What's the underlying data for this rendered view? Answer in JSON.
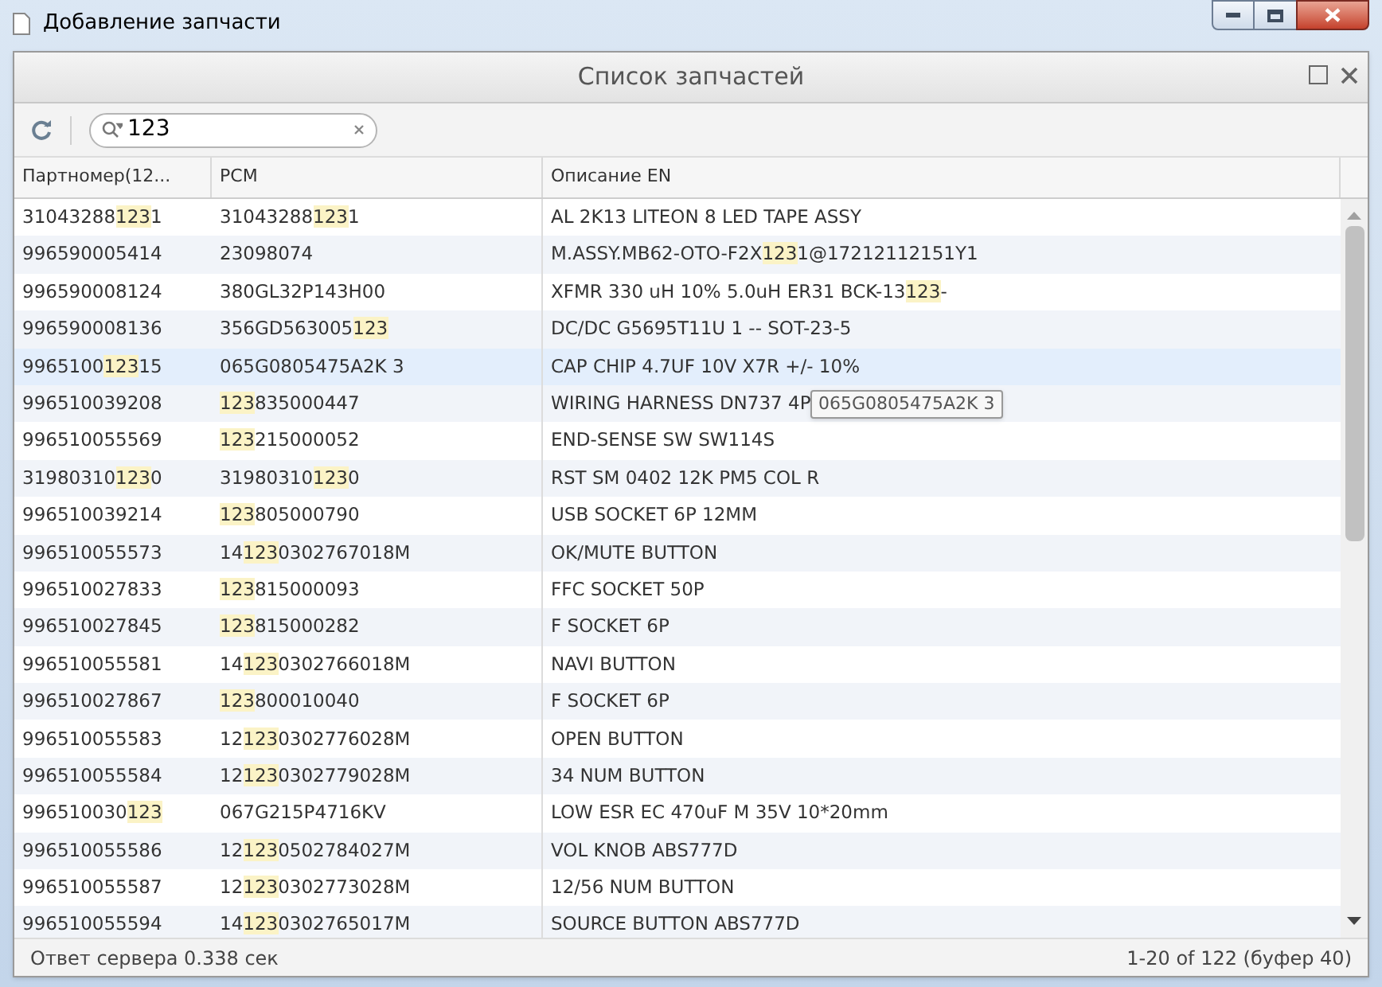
{
  "window": {
    "title": "Добавление запчасти"
  },
  "dialog": {
    "title": "Список запчастей"
  },
  "search": {
    "value": "123"
  },
  "table": {
    "columns": [
      "Партномер(12...",
      "PCM",
      "Описание EN"
    ],
    "rows": [
      {
        "selected": false,
        "cells": [
          [
            {
              "text": "31043288",
              "match": false
            },
            {
              "text": "123",
              "match": true
            },
            {
              "text": "1",
              "match": false
            }
          ],
          [
            {
              "text": "31043288",
              "match": false
            },
            {
              "text": "123",
              "match": true
            },
            {
              "text": "1",
              "match": false
            }
          ],
          [
            {
              "text": "AL 2K13 LITEON 8 LED TAPE ASSY",
              "match": false
            }
          ]
        ]
      },
      {
        "selected": false,
        "cells": [
          [
            {
              "text": "996590005414",
              "match": false
            }
          ],
          [
            {
              "text": "23098074",
              "match": false
            }
          ],
          [
            {
              "text": "M.ASSY.MB62-OTO-F2X",
              "match": false
            },
            {
              "text": "123",
              "match": true
            },
            {
              "text": "1@17212112151Y1",
              "match": false
            }
          ]
        ]
      },
      {
        "selected": false,
        "cells": [
          [
            {
              "text": "996590008124",
              "match": false
            }
          ],
          [
            {
              "text": "380GL32P143H00",
              "match": false
            }
          ],
          [
            {
              "text": "XFMR 330 uH 10% 5.0uH ER31 BCK-13",
              "match": false
            },
            {
              "text": "123",
              "match": true
            },
            {
              "text": "-",
              "match": false
            }
          ]
        ]
      },
      {
        "selected": false,
        "cells": [
          [
            {
              "text": "996590008136",
              "match": false
            }
          ],
          [
            {
              "text": "356GD563005",
              "match": false
            },
            {
              "text": "123",
              "match": true
            }
          ],
          [
            {
              "text": "DC/DC G5695T11U 1 -- SOT-23-5",
              "match": false
            }
          ]
        ]
      },
      {
        "selected": true,
        "cells": [
          [
            {
              "text": "9965100",
              "match": false
            },
            {
              "text": "123",
              "match": true
            },
            {
              "text": "15",
              "match": false
            }
          ],
          [
            {
              "text": "065G0805475A2K 3",
              "match": false
            }
          ],
          [
            {
              "text": "CAP CHIP 4.7UF 10V X7R +/- 10%",
              "match": false
            }
          ]
        ]
      },
      {
        "selected": false,
        "cells": [
          [
            {
              "text": "996510039208",
              "match": false
            }
          ],
          [
            {
              "text": "123",
              "match": true
            },
            {
              "text": "835000447",
              "match": false
            }
          ],
          [
            {
              "text": "WIRING HARNESS DN737 4P",
              "match": false
            }
          ]
        ]
      },
      {
        "selected": false,
        "cells": [
          [
            {
              "text": "996510055569",
              "match": false
            }
          ],
          [
            {
              "text": "123",
              "match": true
            },
            {
              "text": "215000052",
              "match": false
            }
          ],
          [
            {
              "text": "END-SENSE SW SW114S",
              "match": false
            }
          ]
        ]
      },
      {
        "selected": false,
        "cells": [
          [
            {
              "text": "31980310",
              "match": false
            },
            {
              "text": "123",
              "match": true
            },
            {
              "text": "0",
              "match": false
            }
          ],
          [
            {
              "text": "31980310",
              "match": false
            },
            {
              "text": "123",
              "match": true
            },
            {
              "text": "0",
              "match": false
            }
          ],
          [
            {
              "text": "RST SM 0402 12K PM5 COL R",
              "match": false
            }
          ]
        ]
      },
      {
        "selected": false,
        "cells": [
          [
            {
              "text": "996510039214",
              "match": false
            }
          ],
          [
            {
              "text": "123",
              "match": true
            },
            {
              "text": "805000790",
              "match": false
            }
          ],
          [
            {
              "text": "USB SOCKET 6P 12MM",
              "match": false
            }
          ]
        ]
      },
      {
        "selected": false,
        "cells": [
          [
            {
              "text": "996510055573",
              "match": false
            }
          ],
          [
            {
              "text": "14",
              "match": false
            },
            {
              "text": "123",
              "match": true
            },
            {
              "text": "0302767018M",
              "match": false
            }
          ],
          [
            {
              "text": "OK/MUTE BUTTON",
              "match": false
            }
          ]
        ]
      },
      {
        "selected": false,
        "cells": [
          [
            {
              "text": "996510027833",
              "match": false
            }
          ],
          [
            {
              "text": "123",
              "match": true
            },
            {
              "text": "815000093",
              "match": false
            }
          ],
          [
            {
              "text": "FFC SOCKET 50P",
              "match": false
            }
          ]
        ]
      },
      {
        "selected": false,
        "cells": [
          [
            {
              "text": "996510027845",
              "match": false
            }
          ],
          [
            {
              "text": "123",
              "match": true
            },
            {
              "text": "815000282",
              "match": false
            }
          ],
          [
            {
              "text": "F SOCKET 6P",
              "match": false
            }
          ]
        ]
      },
      {
        "selected": false,
        "cells": [
          [
            {
              "text": "996510055581",
              "match": false
            }
          ],
          [
            {
              "text": "14",
              "match": false
            },
            {
              "text": "123",
              "match": true
            },
            {
              "text": "0302766018M",
              "match": false
            }
          ],
          [
            {
              "text": "NAVI BUTTON",
              "match": false
            }
          ]
        ]
      },
      {
        "selected": false,
        "cells": [
          [
            {
              "text": "996510027867",
              "match": false
            }
          ],
          [
            {
              "text": "123",
              "match": true
            },
            {
              "text": "800010040",
              "match": false
            }
          ],
          [
            {
              "text": "F SOCKET 6P",
              "match": false
            }
          ]
        ]
      },
      {
        "selected": false,
        "cells": [
          [
            {
              "text": "996510055583",
              "match": false
            }
          ],
          [
            {
              "text": "12",
              "match": false
            },
            {
              "text": "123",
              "match": true
            },
            {
              "text": "0302776028M",
              "match": false
            }
          ],
          [
            {
              "text": "OPEN BUTTON",
              "match": false
            }
          ]
        ]
      },
      {
        "selected": false,
        "cells": [
          [
            {
              "text": "996510055584",
              "match": false
            }
          ],
          [
            {
              "text": "12",
              "match": false
            },
            {
              "text": "123",
              "match": true
            },
            {
              "text": "0302779028M",
              "match": false
            }
          ],
          [
            {
              "text": "34 NUM BUTTON",
              "match": false
            }
          ]
        ]
      },
      {
        "selected": false,
        "cells": [
          [
            {
              "text": "996510030",
              "match": false
            },
            {
              "text": "123",
              "match": true
            }
          ],
          [
            {
              "text": "067G215P4716KV",
              "match": false
            }
          ],
          [
            {
              "text": "LOW ESR EC 470uF M 35V 10*20mm",
              "match": false
            }
          ]
        ]
      },
      {
        "selected": false,
        "cells": [
          [
            {
              "text": "996510055586",
              "match": false
            }
          ],
          [
            {
              "text": "12",
              "match": false
            },
            {
              "text": "123",
              "match": true
            },
            {
              "text": "0502784027M",
              "match": false
            }
          ],
          [
            {
              "text": "VOL KNOB ABS777D",
              "match": false
            }
          ]
        ]
      },
      {
        "selected": false,
        "cells": [
          [
            {
              "text": "996510055587",
              "match": false
            }
          ],
          [
            {
              "text": "12",
              "match": false
            },
            {
              "text": "123",
              "match": true
            },
            {
              "text": "0302773028M",
              "match": false
            }
          ],
          [
            {
              "text": "12/56 NUM BUTTON",
              "match": false
            }
          ]
        ]
      },
      {
        "selected": false,
        "cells": [
          [
            {
              "text": "996510055594",
              "match": false
            }
          ],
          [
            {
              "text": "14",
              "match": false
            },
            {
              "text": "123",
              "match": true
            },
            {
              "text": "0302765017M",
              "match": false
            }
          ],
          [
            {
              "text": "SOURCE BUTTON ABS777D",
              "match": false
            }
          ]
        ]
      }
    ]
  },
  "tooltip": {
    "text": "065G0805475A2K  3"
  },
  "status_bar": {
    "left": "Ответ сервера 0.338 сек",
    "right": "1-20 of 122 (буфер 40)"
  }
}
